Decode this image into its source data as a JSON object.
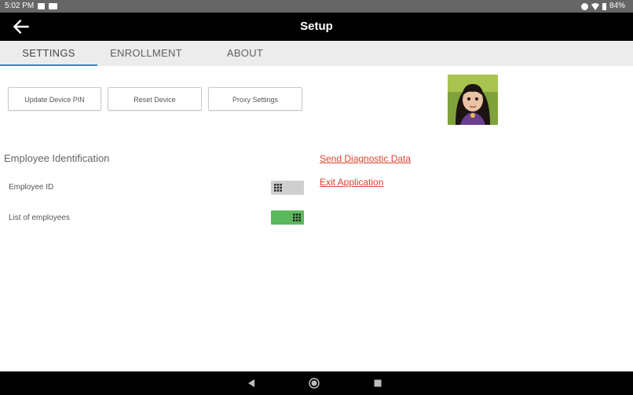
{
  "status_bar": {
    "time": "5:02 PM",
    "battery": "84%"
  },
  "app_bar": {
    "title": "Setup"
  },
  "tabs": [
    {
      "label": "SETTINGS",
      "active": true
    },
    {
      "label": "ENROLLMENT",
      "active": false
    },
    {
      "label": "ABOUT",
      "active": false
    }
  ],
  "buttons": {
    "update_pin": "Update Device PIN",
    "reset_device": "Reset Device",
    "proxy_settings": "Proxy Settings"
  },
  "employee_identification": {
    "title": "Employee Identification",
    "employee_id": {
      "label": "Employee ID",
      "enabled": false
    },
    "list_of_employees": {
      "label": "List of employees",
      "enabled": true
    }
  },
  "links": {
    "send_diagnostic": "Send Diagnostic Data",
    "exit_application": "Exit Application"
  },
  "colors": {
    "accent": "#2a8fbf",
    "toggle_on": "#5cb85c",
    "toggle_off": "#cfcfcf",
    "link": "#d9442c"
  }
}
